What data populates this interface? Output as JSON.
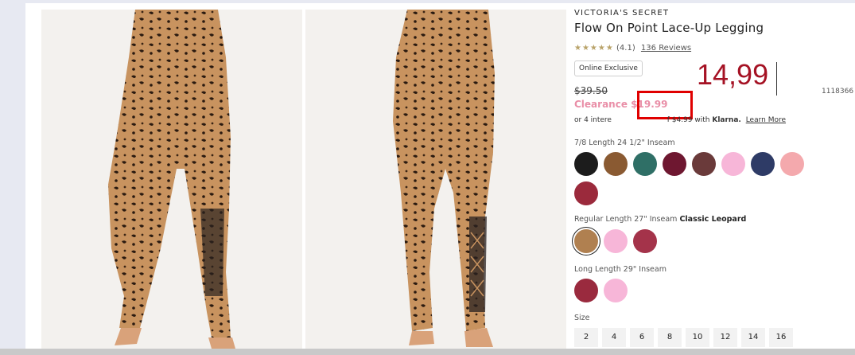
{
  "product": {
    "brand": "VICTORIA'S SECRET",
    "name": "Flow On Point Lace-Up Legging",
    "stars": "★★★★★",
    "rating": "(4.1)",
    "reviews": "136 Reviews",
    "badge": "Online Exclusive",
    "original_price": "$39.50",
    "clearance_price": "Clearance $19.99",
    "klarna_prefix": "or 4 intere",
    "klarna_mid": "f $4.99 with",
    "klarna_brand": "Klarna.",
    "klarna_link": "Learn More",
    "sku": "1118366"
  },
  "overlay": {
    "price_text": "14,99"
  },
  "variants": [
    {
      "label": "7/8 Length 24 1/2\" Inseam",
      "selected_name": "",
      "swatches": [
        {
          "color": "#1c1c1c"
        },
        {
          "color": "#8a5a32"
        },
        {
          "color": "#2f6f66"
        },
        {
          "color": "#6e1730"
        },
        {
          "color": "#6a3a3a"
        },
        {
          "color": "#f7b6d8"
        },
        {
          "color": "#2e3b66"
        },
        {
          "color": "#f4a9ad"
        },
        {
          "color": "#9b2a3c"
        }
      ]
    },
    {
      "label": "Regular Length 27\" Inseam",
      "selected_name": "Classic Leopard",
      "swatches": [
        {
          "color": "#b08050",
          "selected": true
        },
        {
          "color": "#f7b6d8"
        },
        {
          "color": "#a4334a"
        }
      ]
    },
    {
      "label": "Long Length 29\" Inseam",
      "selected_name": "",
      "swatches": [
        {
          "color": "#9a2a3e"
        },
        {
          "color": "#f7b6d8"
        }
      ]
    }
  ],
  "size_label": "Size",
  "sizes": [
    "2",
    "4",
    "6",
    "8",
    "10",
    "12",
    "14",
    "16"
  ]
}
